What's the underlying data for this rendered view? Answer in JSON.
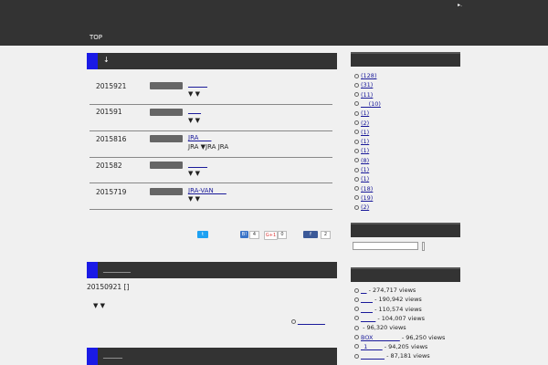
{
  "header": {
    "top_right": "▸.",
    "nav_top": "TOP"
  },
  "main": {
    "section_arrow": "↓",
    "posts": [
      {
        "date": "2015921",
        "link": "______",
        "excerpt": "▼ ▼"
      },
      {
        "date": "201591",
        "link": "____",
        "excerpt": "▼ ▼"
      },
      {
        "date": "2015816",
        "link": "JRA____",
        "excerpt": "JRA ▼JRA JRA"
      },
      {
        "date": "201582",
        "link": "______",
        "excerpt": "▼ ▼"
      },
      {
        "date": "2015719",
        "link": "JRA-VAN____",
        "excerpt": "▼ ▼"
      }
    ],
    "share": {
      "hatena_count": "4",
      "gplus_count": "0",
      "fb_count": "2",
      "gplus_label": "G+1",
      "hatena_label": "B!",
      "twitter_label": "t",
      "fb_label": "f"
    },
    "section2_title": "__________",
    "post2_date": "20150921 []",
    "post2_excerpt": "▼ ▼",
    "post2_more": "__________",
    "section3_title": "_______"
  },
  "sidebar": {
    "categories": [
      "(128)",
      "(31)",
      "(11)",
      "__ (10)",
      "(1)",
      "(2)",
      "(1)",
      "(1)",
      "(1)",
      "(8)",
      "(1)",
      "(1)",
      "(18)",
      "(19)",
      "(2)"
    ],
    "popular": [
      {
        "link": "__",
        "views": " - 274,717 views"
      },
      {
        "link": "____",
        "views": " - 190,942 views"
      },
      {
        "link": "____",
        "views": " - 110,574 views"
      },
      {
        "link": "_____",
        "views": " - 104,007 views"
      },
      {
        "link": "",
        "views": " - 96,320 views"
      },
      {
        "link": "BOX_________",
        "views": " - 96,250 views"
      },
      {
        "link": "_1_____",
        "views": " - 94,205 views"
      },
      {
        "link": "________",
        "views": " - 87,181 views"
      }
    ]
  }
}
